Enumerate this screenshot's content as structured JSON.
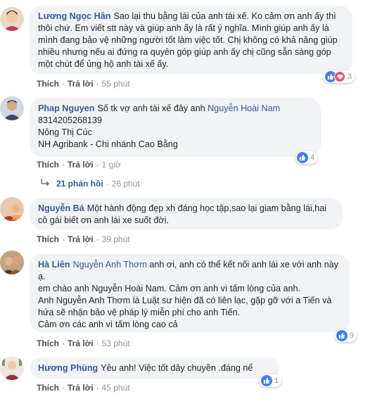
{
  "comments": [
    {
      "author": "Lương Ngọc Hân",
      "text": "Sao lại thu bằng lái của anh tài xế. Ko cảm ơn anh ấy thì thôi chứ. Em viết stt này và giúp anh ấy là rất ý nghĩa. Mình giúp anh ấy là mình đang bảo vệ những người tốt làm việc tốt. Chị không có khả năng giúp nhiều nhưng nếu ai đứng ra quyên góp giúp anh ấy chị cũng sẵn sàng góp một chút để ủng hộ anh tài xế ấy.",
      "like": "Thích",
      "reply": "Trả lời",
      "time": "55 phút",
      "reactions": "3"
    },
    {
      "author": "Phap Nguyen",
      "text": "Số tk vợ anh tài xế đây anh",
      "mention": "Nguyễn Hoài Nam",
      "lines": [
        "8314205268139",
        "Nông Thị Cúc",
        "NH Agribank - Chi nhánh Cao Bằng"
      ],
      "like": "Thích",
      "reply": "Trả lời",
      "time": "1 giờ",
      "reactions": "4"
    },
    {
      "author": "Nguyễn Bá",
      "text": "Một hành động đẹp xh đáng học tập,sao lại giam bằng lái,hai cô gái biết ơn anh lái xe suốt đời.",
      "like": "Thích",
      "reply": "Trả lời",
      "time": "39 phút"
    },
    {
      "author": "Hà Liên",
      "mention": "Nguyễn Anh Thơm",
      "text": "anh ơi, anh có thể kết nối anh lái xe với anh này ạ.",
      "lines": [
        "em chào anh Nguyễn Hoài Nam. Cảm ơn anh vì tấm lòng của anh.",
        "Anh Nguyễn Anh Thơm là Luật sư hiện đã có liên lạc, gặp gỡ với a Tiến và hứa sẽ nhận bảo vệ pháp lý miễn phí cho anh Tiến.",
        "Cảm ơn các anh vì tấm lòng cao cả"
      ],
      "like": "Thích",
      "reply": "Trả lời",
      "time": "53 phút",
      "reactions": "9"
    },
    {
      "author": "Hương Phùng",
      "text": "Yêu anh! Việc tốt dây chuyền .đáng nể",
      "like": "Thích",
      "reply": "Trả lời",
      "time": "45 phút",
      "reactions": "1"
    }
  ],
  "replies_summary": {
    "label": "21 phản hồi",
    "time": "26 phút"
  },
  "separator": "·"
}
